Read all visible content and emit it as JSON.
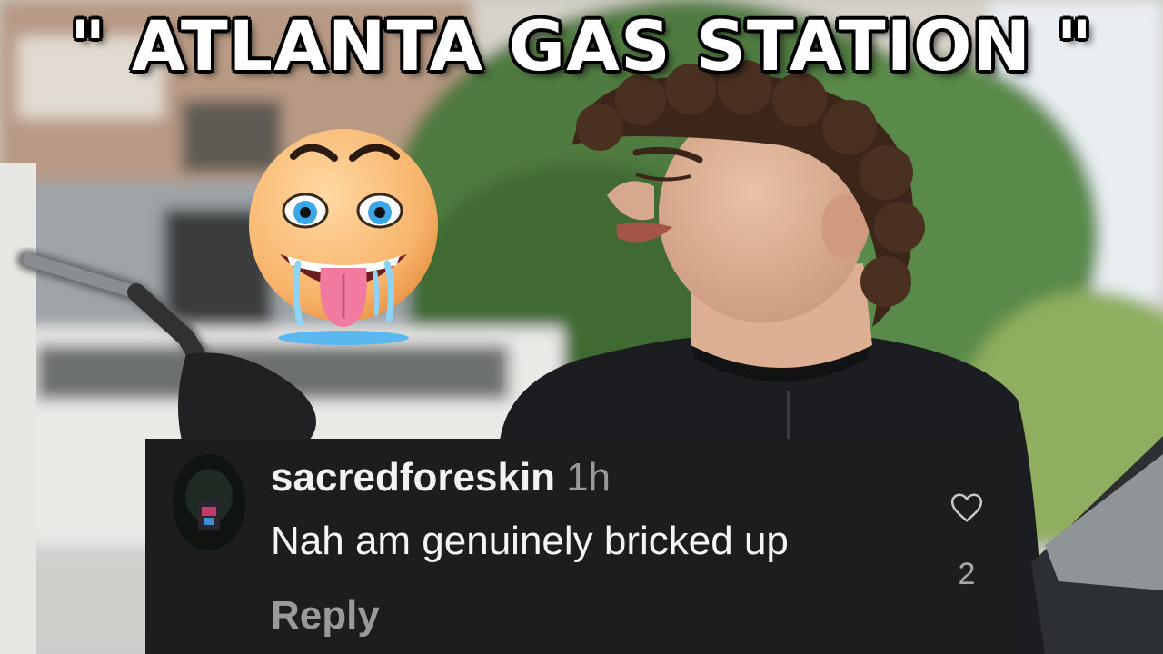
{
  "title": "\" ATLANTA GAS STATION \"",
  "comment": {
    "username": "sacredforeskin",
    "time": "1h",
    "text": "Nah am genuinely bricked up",
    "reply_label": "Reply",
    "like_count": "2",
    "heart_icon": "heart-outline-icon"
  },
  "colors": {
    "comment_bg": "#1d1d1d",
    "meta_grey": "#9a9a9a",
    "title_text": "#ffffff"
  }
}
